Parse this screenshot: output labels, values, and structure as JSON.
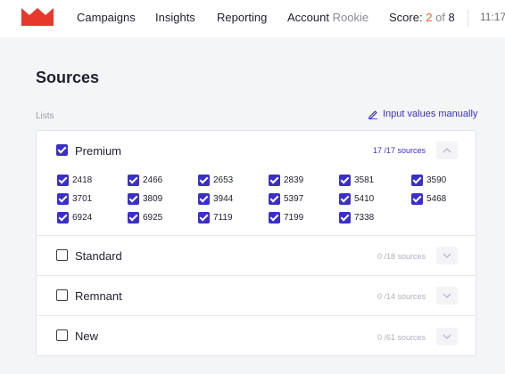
{
  "topbar": {
    "logo": "crown-icon",
    "nav": [
      "Campaigns",
      "Insights",
      "Reporting",
      "Account"
    ],
    "account_rank": "Rookie",
    "score_label": "Score:",
    "score_current": "2",
    "score_of": "of",
    "score_total": "8",
    "clock": "11:17"
  },
  "page": {
    "title": "Sources",
    "lists_label": "Lists",
    "manual_link": "Input values manually"
  },
  "lists": [
    {
      "name": "Premium",
      "checked": true,
      "count": "17 /17",
      "count_suffix": "sources",
      "expanded": true,
      "sources": [
        "2418",
        "2466",
        "2653",
        "2839",
        "3581",
        "3590",
        "3701",
        "3809",
        "3944",
        "5397",
        "5410",
        "5468",
        "6924",
        "6925",
        "7119",
        "7199",
        "7338"
      ]
    },
    {
      "name": "Standard",
      "checked": false,
      "count": "0 /18",
      "count_suffix": "sources",
      "expanded": false
    },
    {
      "name": "Remnant",
      "checked": false,
      "count": "0 /14",
      "count_suffix": "sources",
      "expanded": false
    },
    {
      "name": "New",
      "checked": false,
      "count": "0 /61",
      "count_suffix": "sources",
      "expanded": false
    }
  ],
  "colors": {
    "accent": "#3b2fc9",
    "logo": "#e8382c",
    "score_current": "#e8602c"
  }
}
